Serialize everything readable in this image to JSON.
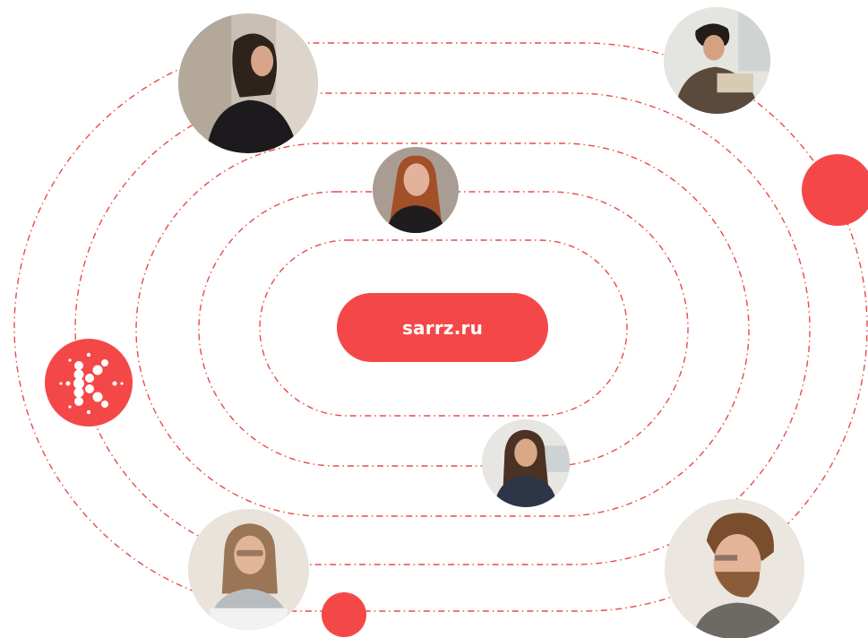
{
  "center_button": {
    "label": "sarrz.ru"
  },
  "colors": {
    "accent": "#f44848",
    "orbit_line": "#e84a4a",
    "background": "#ffffff"
  },
  "icons": {
    "logo": "molecule-k-logo-icon"
  },
  "avatars": [
    {
      "name": "woman-dark-hair-looking-away-photo"
    },
    {
      "name": "man-glasses-reading-photo"
    },
    {
      "name": "smiling-red-haired-woman-photo"
    },
    {
      "name": "woman-at-desk-smiling-photo"
    },
    {
      "name": "woman-glasses-laptop-photo"
    },
    {
      "name": "bearded-man-profile-photo"
    }
  ]
}
